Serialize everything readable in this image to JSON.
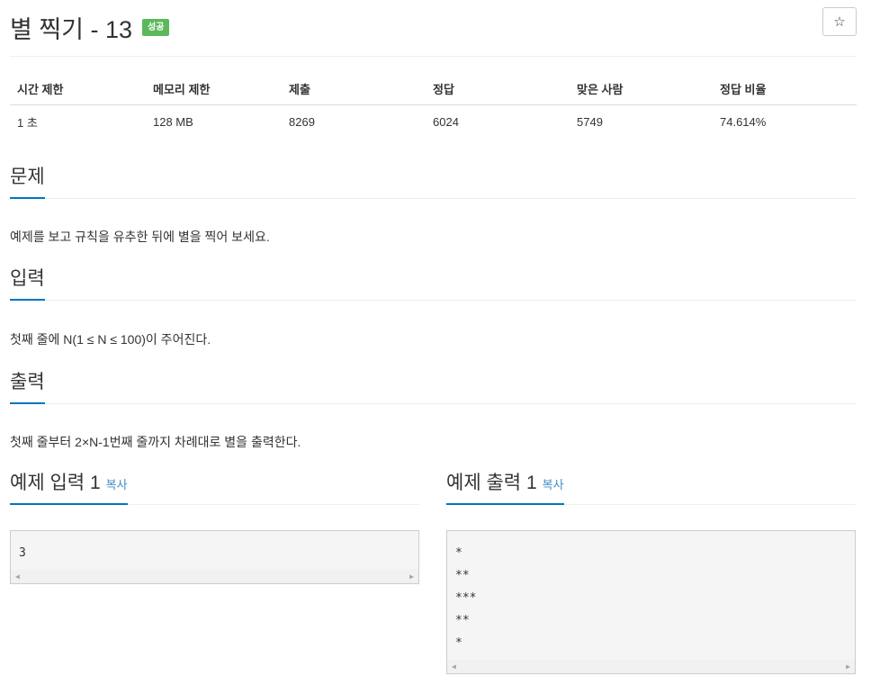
{
  "problem": {
    "title": "별 찍기 - 13",
    "badge": "성공",
    "star_icon": "☆"
  },
  "stats": {
    "headers": [
      "시간 제한",
      "메모리 제한",
      "제출",
      "정답",
      "맞은 사람",
      "정답 비율"
    ],
    "values": [
      "1 초",
      "128 MB",
      "8269",
      "6024",
      "5749",
      "74.614%"
    ]
  },
  "sections": {
    "description": {
      "title": "문제",
      "text": "예제를 보고 규칙을 유추한 뒤에 별을 찍어 보세요."
    },
    "input": {
      "title": "입력",
      "text": "첫째 줄에 N(1 ≤ N ≤ 100)이 주어진다."
    },
    "output": {
      "title": "출력",
      "text": "첫째 줄부터 2×N-1번째 줄까지 차례대로 별을 출력한다."
    }
  },
  "samples": {
    "input": {
      "title": "예제 입력 1",
      "copy": "복사",
      "content": "3"
    },
    "output": {
      "title": "예제 출력 1",
      "copy": "복사",
      "content": "*\n**\n***\n**\n*"
    }
  },
  "colors": {
    "accent": "#0076c0",
    "success": "#5cb85c",
    "link": "#428bca"
  }
}
